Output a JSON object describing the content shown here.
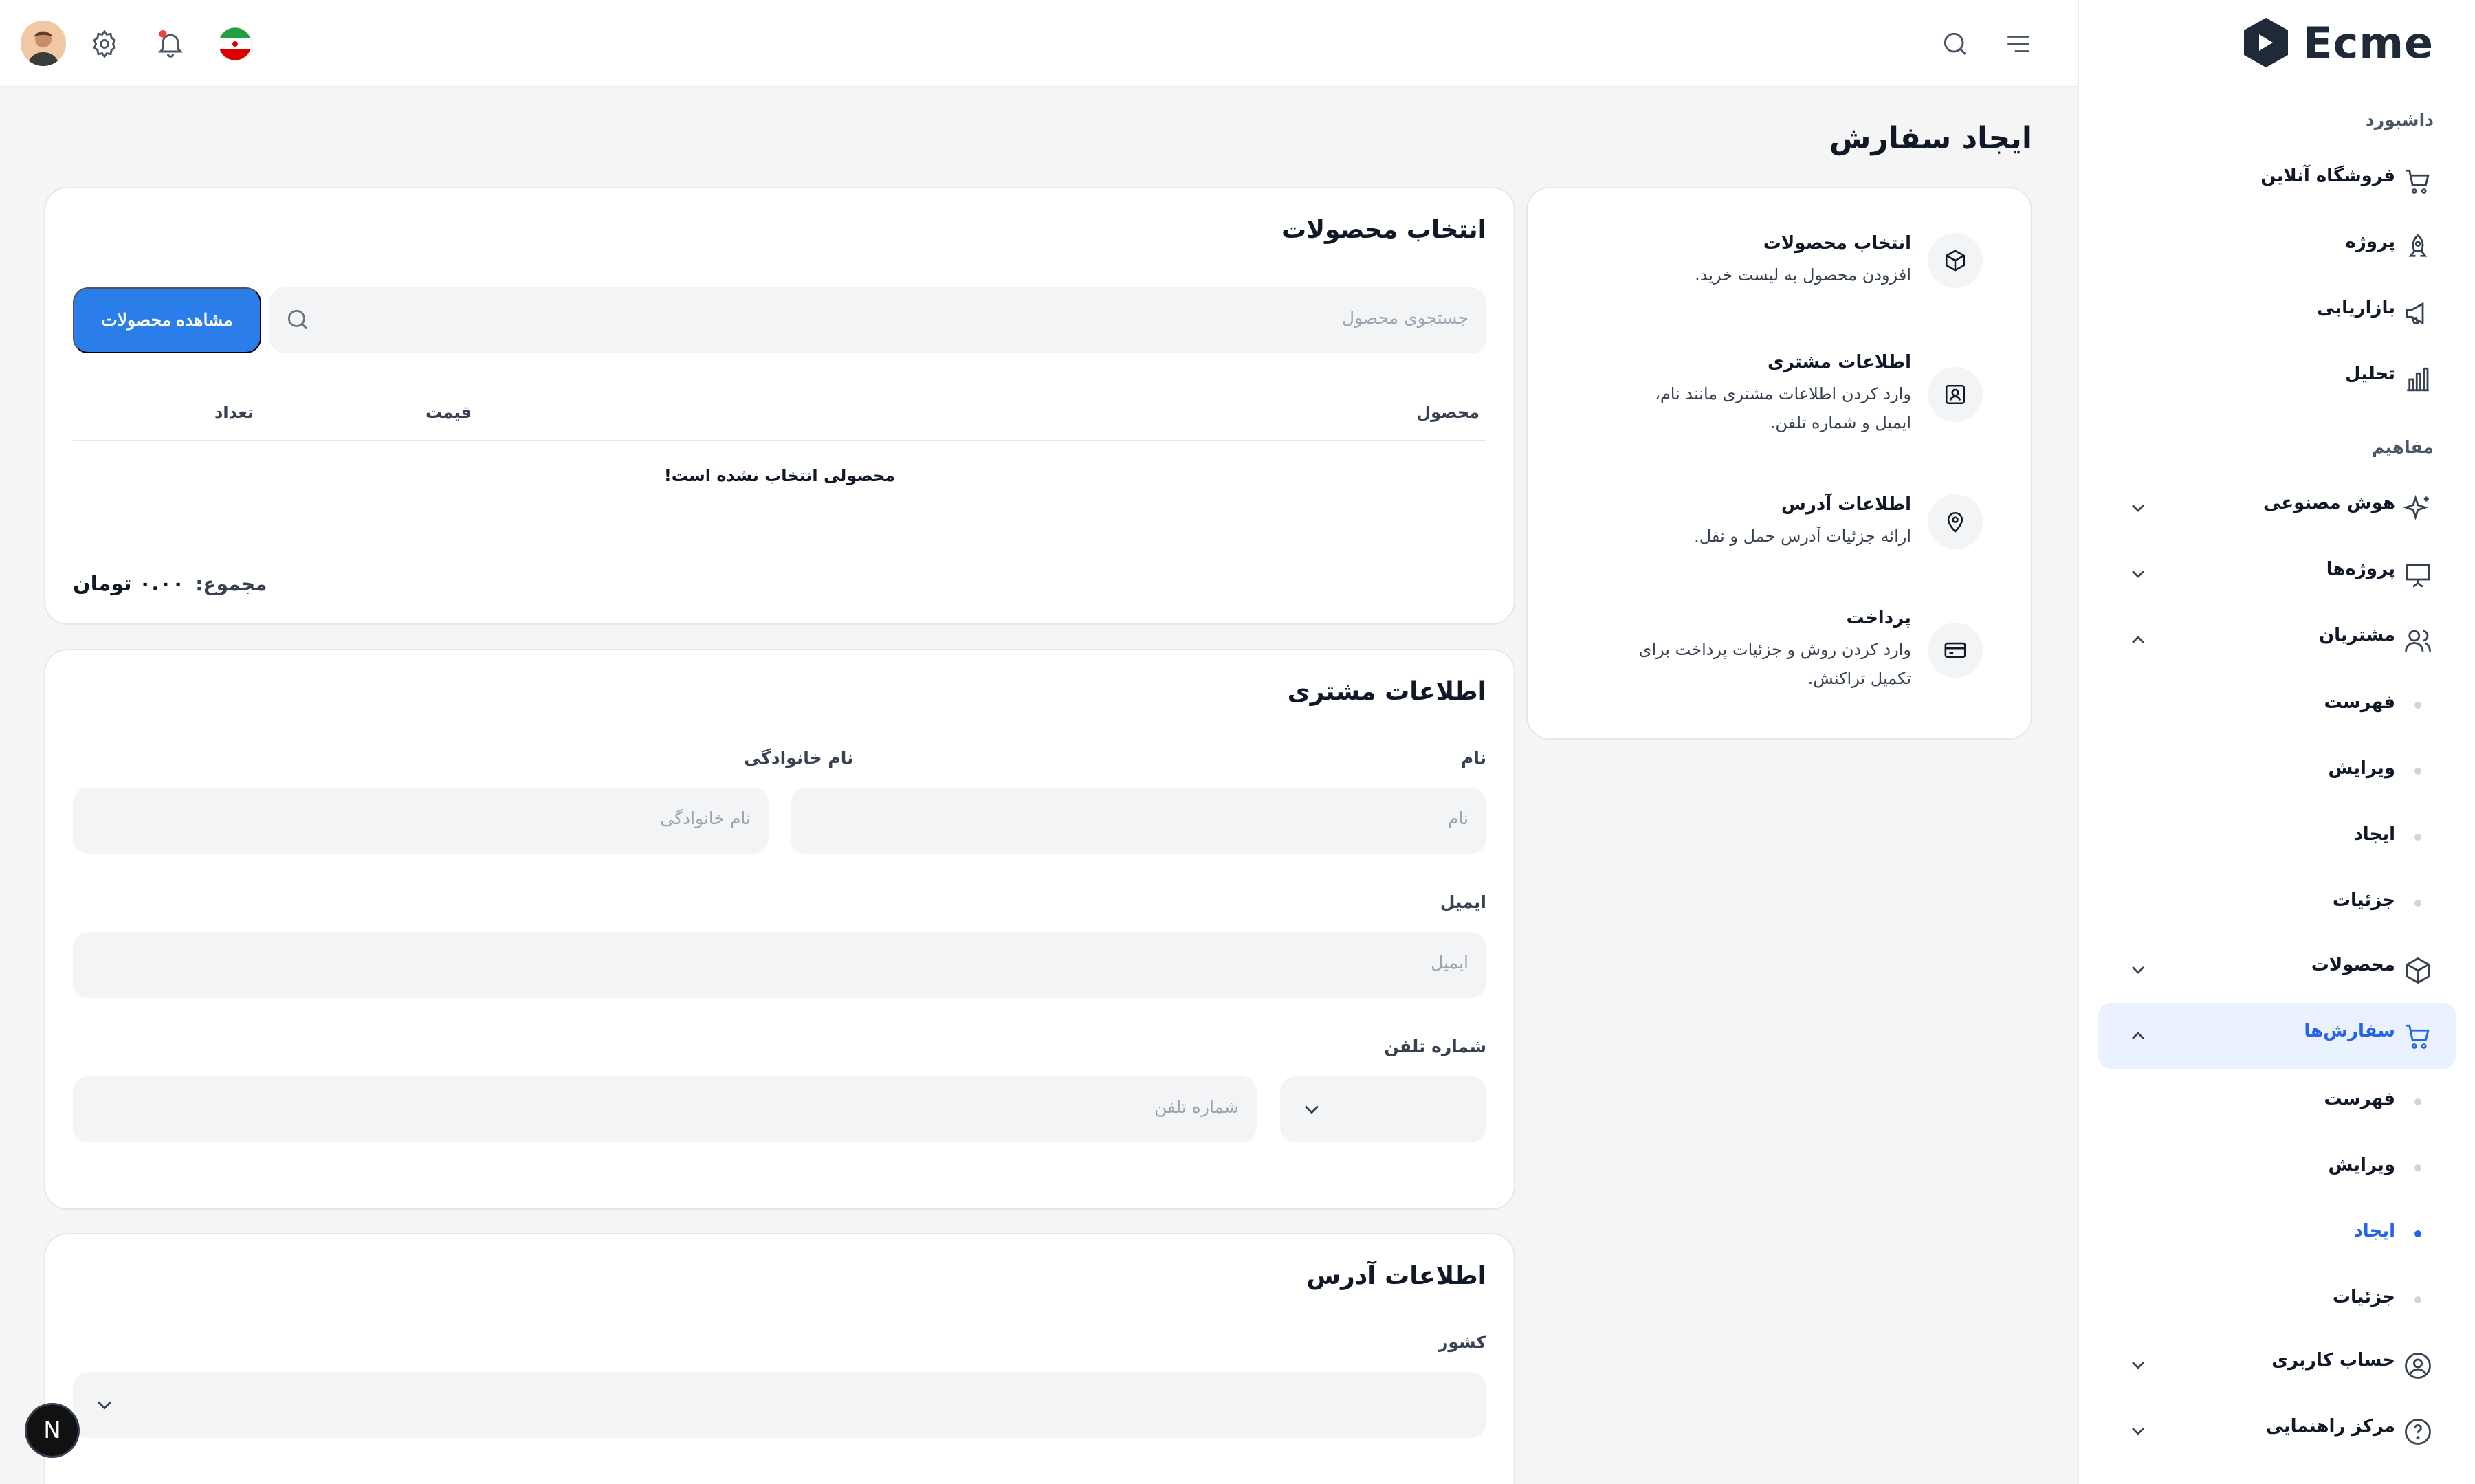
{
  "app": {
    "logo_text": "Ecme"
  },
  "sidebar": {
    "section_dashboard": "داشبورد",
    "section_concepts": "مفاهیم",
    "items": [
      {
        "label": "فروشگاه آنلاین",
        "icon": "cart-icon"
      },
      {
        "label": "پروژه",
        "icon": "rocket-icon"
      },
      {
        "label": "بازاریابی",
        "icon": "megaphone-icon"
      },
      {
        "label": "تحلیل",
        "icon": "bar-chart-icon"
      },
      {
        "label": "هوش مصنوعی",
        "icon": "sparkle-icon"
      },
      {
        "label": "پروژه‌ها",
        "icon": "presentation-icon"
      },
      {
        "label": "مشتریان",
        "icon": "users-icon"
      },
      {
        "label": "محصولات",
        "icon": "box-icon"
      },
      {
        "label": "سفارش‌ها",
        "icon": "cart-icon"
      },
      {
        "label": "حساب کاربری",
        "icon": "user-circle-icon"
      },
      {
        "label": "مرکز راهنمایی",
        "icon": "help-circle-icon"
      }
    ],
    "customers_sub": [
      "فهرست",
      "ویرایش",
      "ایجاد",
      "جزئیات"
    ],
    "orders_sub": [
      "فهرست",
      "ویرایش",
      "ایجاد",
      "جزئیات"
    ]
  },
  "page": {
    "title": "ایجاد سفارش"
  },
  "steps": [
    {
      "title": "انتخاب محصولات",
      "desc": "افزودن محصول به لیست خرید."
    },
    {
      "title": "اطلاعات مشتری",
      "desc": "وارد کردن اطلاعات مشتری مانند نام، ایمیل و شماره تلفن."
    },
    {
      "title": "اطلاعات آدرس",
      "desc": "ارائه جزئیات آدرس حمل و نقل."
    },
    {
      "title": "پرداخت",
      "desc": "وارد کردن روش و جزئیات پرداخت برای تکمیل تراکنش."
    }
  ],
  "products": {
    "title": "انتخاب محصولات",
    "search_placeholder": "جستجوی محصول",
    "view_button": "مشاهده محصولات",
    "columns": [
      "محصول",
      "قیمت",
      "تعداد"
    ],
    "empty": "محصولی انتخاب نشده است!",
    "total_label": "مجموع:",
    "total_value": "۰.۰۰ تومان"
  },
  "customer": {
    "title": "اطلاعات مشتری",
    "first_name_label": "نام",
    "first_name_placeholder": "نام",
    "last_name_label": "نام خانوادگی",
    "last_name_placeholder": "نام خانوادگی",
    "email_label": "ایمیل",
    "email_placeholder": "ایمیل",
    "phone_label": "شماره تلفن",
    "phone_placeholder": "شماره تلفن"
  },
  "address": {
    "title": "اطلاعات آدرس",
    "country_label": "کشور"
  },
  "floating": {
    "letter": "N"
  }
}
